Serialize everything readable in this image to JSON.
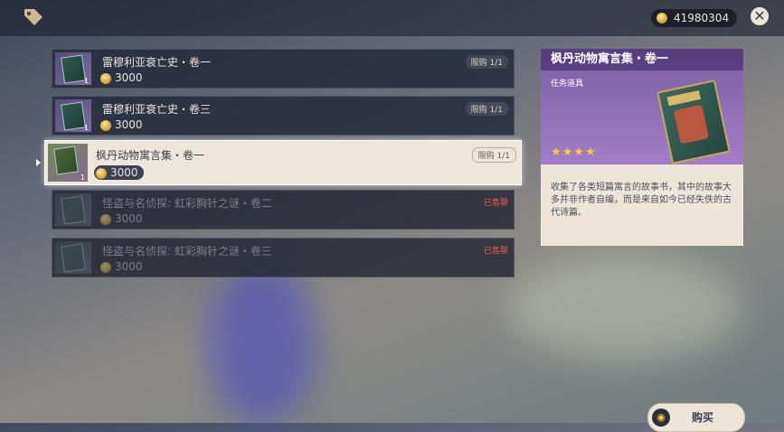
{
  "header": {
    "currency_value": "41980304",
    "close_icon": "close-icon",
    "shop_icon": "tag-icon"
  },
  "items": [
    {
      "name": "雷穆利亚衰亡史・卷一",
      "price": "3000",
      "limit": "限购 1/1",
      "count": "1",
      "status": "available"
    },
    {
      "name": "雷穆利亚衰亡史・卷三",
      "price": "3000",
      "limit": "限购 1/1",
      "count": "1",
      "status": "available"
    },
    {
      "name": "枫丹动物寓言集・卷一",
      "price": "3000",
      "limit": "限购 1/1",
      "count": "1",
      "status": "selected"
    },
    {
      "name": "怪盗与名侦探: 虹彩胸针之谜・卷二",
      "price": "3000",
      "soldout": "已售罄",
      "status": "soldout"
    },
    {
      "name": "怪盗与名侦探: 虹彩胸针之谜・卷三",
      "price": "3000",
      "soldout": "已售罄",
      "status": "soldout"
    }
  ],
  "detail": {
    "title": "枫丹动物寓言集・卷一",
    "type": "任务道具",
    "stars": "★★★★",
    "description": "收集了各类短篇寓言的故事书，其中的故事大多并非作者自编，而是来自如今已经失佚的古代诗篇。"
  },
  "buy": {
    "label": "购买",
    "key_hint": "◉"
  },
  "colors": {
    "accent_purple": "#a27ec6",
    "soldout_red": "#e35d4c",
    "star_gold": "#ffcc32",
    "panel_cream": "#ece5d8"
  }
}
